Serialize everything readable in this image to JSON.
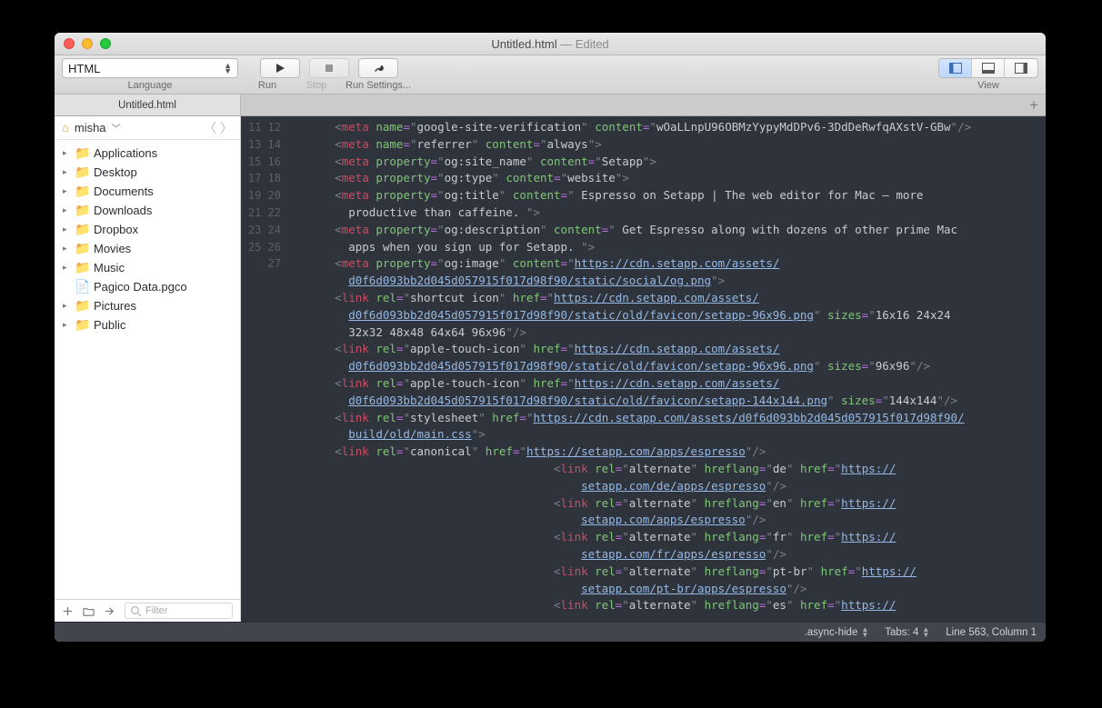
{
  "window": {
    "title": "Untitled.html",
    "edited": " — Edited"
  },
  "toolbar": {
    "language_value": "HTML",
    "language_label": "Language",
    "run_label": "Run",
    "stop_label": "Stop",
    "settings_label": "Run Settings...",
    "view_label": "View"
  },
  "tab": {
    "name": "Untitled.html"
  },
  "sidebar": {
    "user": "misha",
    "items": [
      {
        "type": "folder",
        "label": "Applications"
      },
      {
        "type": "folder",
        "label": "Desktop"
      },
      {
        "type": "folder",
        "label": "Documents"
      },
      {
        "type": "folder",
        "label": "Downloads"
      },
      {
        "type": "folder",
        "label": "Dropbox"
      },
      {
        "type": "folder",
        "label": "Movies"
      },
      {
        "type": "folder",
        "label": "Music"
      },
      {
        "type": "file",
        "label": "Pagico Data.pgco"
      },
      {
        "type": "folder",
        "label": "Pictures"
      },
      {
        "type": "folder",
        "label": "Public"
      }
    ],
    "filter_placeholder": "Filter"
  },
  "gutter": [
    "11",
    "12",
    "13",
    "14",
    "15",
    "",
    "16",
    "",
    "17",
    "",
    "18",
    "",
    "",
    "19",
    "",
    "20",
    "",
    "21",
    "",
    "22",
    "23",
    "",
    "24",
    "",
    "25",
    "",
    "26",
    "",
    "27"
  ],
  "status": {
    "scope": ".async-hide",
    "tabs": "Tabs: 4",
    "pos": "Line 563, Column 1"
  },
  "code": {
    "l11": {
      "name": "google-site-verification",
      "content": "wOaLLnpU96OBMzYypyMdDPv6-3DdDeRwfqAXstV-GBw"
    },
    "l12": {
      "name": "referrer",
      "content": "always"
    },
    "l13": {
      "prop": "og:site_name",
      "content": "Setapp"
    },
    "l14": {
      "prop": "og:type",
      "content": "website"
    },
    "l15": {
      "prop": "og:title",
      "content": " Espresso on Setapp | The web editor for Mac — more productive than caffeine. "
    },
    "l16": {
      "prop": "og:description",
      "content": " Get Espresso along with dozens of other prime Mac apps when you sign up for Setapp. "
    },
    "l17": {
      "prop": "og:image",
      "url1": "https://cdn.setapp.com/assets/",
      "url2": "d0f6d093bb2d045d057915f017d98f90/static/social/og.png"
    },
    "l18": {
      "rel": "shortcut icon",
      "url1": "https://cdn.setapp.com/assets/",
      "url2": "d0f6d093bb2d045d057915f017d98f90/static/old/favicon/setapp-96x96.png",
      "sizes": "16x16 24x24 32x32 48x48 64x64 96x96"
    },
    "l19": {
      "rel": "apple-touch-icon",
      "url1": "https://cdn.setapp.com/assets/",
      "url2": "d0f6d093bb2d045d057915f017d98f90/static/old/favicon/setapp-96x96.png",
      "sizes": "96x96"
    },
    "l20": {
      "rel": "apple-touch-icon",
      "url1": "https://cdn.setapp.com/assets/",
      "url2": "d0f6d093bb2d045d057915f017d98f90/static/old/favicon/setapp-144x144.png",
      "sizes": "144x144"
    },
    "l21": {
      "rel": "stylesheet",
      "url1": "https://cdn.setapp.com/assets/d0f6d093bb2d045d057915f017d98f90/",
      "url2": "build/old/main.css"
    },
    "l22": {
      "rel": "canonical",
      "url": "https://setapp.com/apps/espresso"
    },
    "l23": {
      "hreflang": "de",
      "url1": "https://",
      "url2": "setapp.com/de/apps/espresso"
    },
    "l24": {
      "hreflang": "en",
      "url1": "https://",
      "url2": "setapp.com/apps/espresso"
    },
    "l25": {
      "hreflang": "fr",
      "url1": "https://",
      "url2": "setapp.com/fr/apps/espresso"
    },
    "l26": {
      "hreflang": "pt-br",
      "url1": "https://",
      "url2": "setapp.com/pt-br/apps/espresso"
    },
    "l27": {
      "hreflang": "es",
      "url": "https://"
    }
  }
}
